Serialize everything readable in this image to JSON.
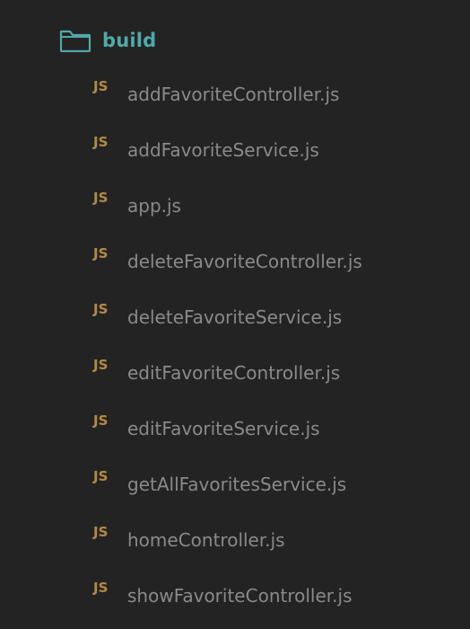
{
  "folder": {
    "name": "build",
    "icon": "folder-open-icon",
    "color": "#52a9a9"
  },
  "file_icon": {
    "label": "JS",
    "icon": "javascript-file-icon",
    "color": "#b58a45"
  },
  "files": [
    "addFavoriteController.js",
    "addFavoriteService.js",
    "app.js",
    "deleteFavoriteController.js",
    "deleteFavoriteService.js",
    "editFavoriteController.js",
    "editFavoriteService.js",
    "getAllFavoritesService.js",
    "homeController.js",
    "showFavoriteController.js"
  ]
}
